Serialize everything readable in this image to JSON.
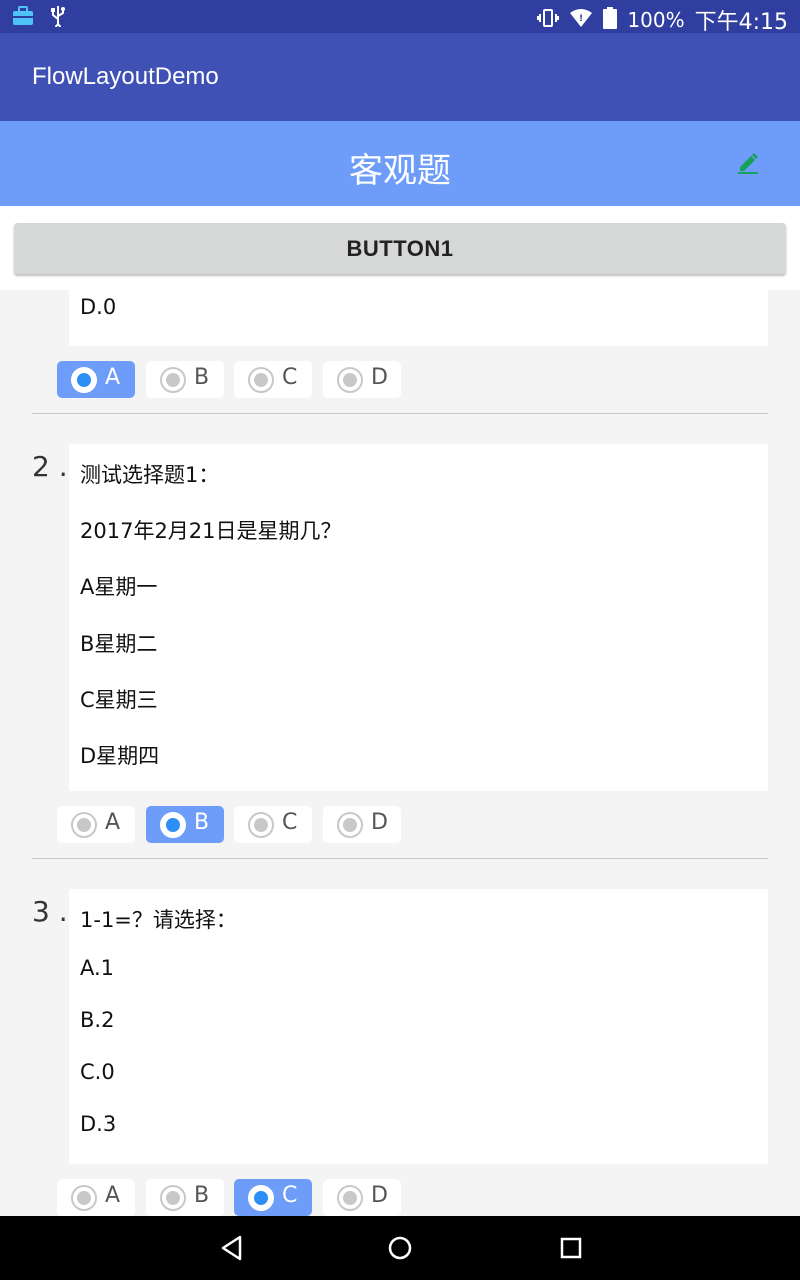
{
  "status_bar": {
    "battery": "100%",
    "time": "下午4:15",
    "icons": [
      "briefcase-icon",
      "usb-icon",
      "vibrate-icon",
      "wifi-icon",
      "battery-icon"
    ]
  },
  "app_bar": {
    "title": "FlowLayoutDemo"
  },
  "sub_bar": {
    "title": "客观题",
    "edit_icon": "pencil-icon"
  },
  "button1": {
    "label": "BUTTON1"
  },
  "questions": [
    {
      "number": "",
      "lines": [
        "D.0"
      ],
      "options": [
        "A",
        "B",
        "C",
        "D"
      ],
      "selected": "A"
    },
    {
      "number": "2 .",
      "lines": [
        "测试选择题1：",
        "2017年2月21日是星期几？",
        "A星期一",
        "B星期二",
        "C星期三",
        "D星期四"
      ],
      "options": [
        "A",
        "B",
        "C",
        "D"
      ],
      "selected": "B"
    },
    {
      "number": "3 .",
      "lines": [
        "1-1=？请选择：",
        "A.1",
        "B.2",
        "C.0",
        "D.3"
      ],
      "options": [
        "A",
        "B",
        "C",
        "D"
      ],
      "selected": "C"
    }
  ],
  "colors": {
    "status_bar": "#303f9f",
    "app_bar": "#3f51b5",
    "sub_bar": "#6d9cf9",
    "selected_option": "#6d9cf9",
    "radio_checked": "#2d8ff6",
    "edit_icon": "#16a05a"
  },
  "nav_bar": {
    "icons": [
      "back-icon",
      "home-icon",
      "recents-icon"
    ]
  }
}
